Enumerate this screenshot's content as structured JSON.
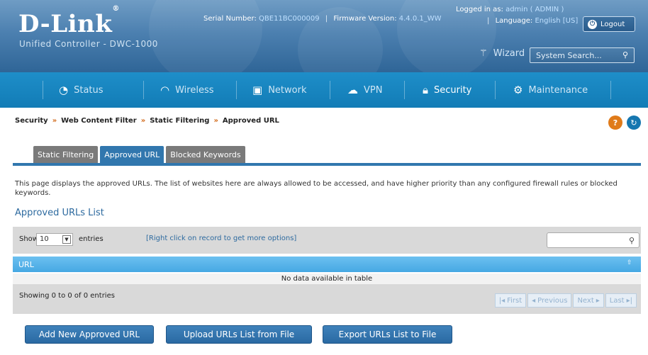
{
  "header": {
    "logo": "D-Link",
    "subtitle": "Unified Controller - DWC-1000",
    "serial_label": "Serial Number:",
    "serial_value": "QBE11BC000009",
    "firmware_label": "Firmware Version:",
    "firmware_value": "4.4.0.1_WW",
    "language_label": "Language:",
    "language_value": "English [US]",
    "logged_label": "Logged in as:",
    "logged_value": "admin ( ADMIN )",
    "logout_label": "Logout",
    "wizard_label": "Wizard",
    "search_placeholder": "System Search..."
  },
  "nav": {
    "items": [
      {
        "label": "Status",
        "icon": "dashboard-icon"
      },
      {
        "label": "Wireless",
        "icon": "wifi-icon"
      },
      {
        "label": "Network",
        "icon": "monitor-icon"
      },
      {
        "label": "VPN",
        "icon": "cloud-lock-icon"
      },
      {
        "label": "Security",
        "icon": "lock-icon"
      },
      {
        "label": "Maintenance",
        "icon": "gears-icon"
      }
    ],
    "active": "Security"
  },
  "breadcrumb": [
    "Security",
    "Web Content Filter",
    "Static Filtering",
    "Approved URL"
  ],
  "tabs": [
    {
      "label": "Static Filtering",
      "active": false
    },
    {
      "label": "Approved URL",
      "active": true
    },
    {
      "label": "Blocked Keywords",
      "active": false
    }
  ],
  "description": "This page displays the approved URLs. The list of websites here are always allowed to be accessed, and have higher priority than any configured firewall rules or blocked keywords.",
  "section_title": "Approved URLs List",
  "table": {
    "show_label": "Show",
    "show_value": "10",
    "entries_label": "entries",
    "hint": "[Right click on record to get more options]",
    "column": "URL",
    "empty_text": "No data available in table",
    "showing_text": "Showing 0 to 0 of 0 entries",
    "pager": {
      "first": "First",
      "previous": "Previous",
      "next": "Next",
      "last": "Last"
    }
  },
  "buttons": {
    "add": "Add New Approved URL",
    "upload": "Upload URLs List from File",
    "export": "Export URLs List to File"
  }
}
